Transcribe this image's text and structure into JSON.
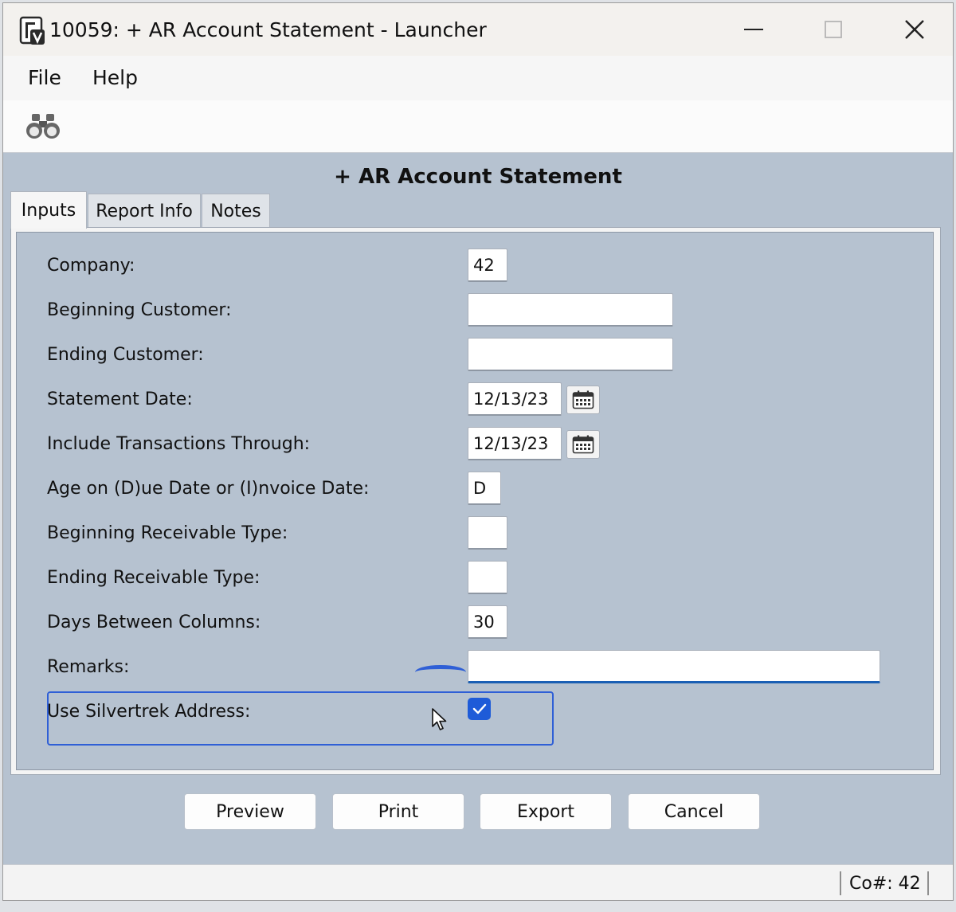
{
  "window": {
    "title": "10059: + AR Account Statement - Launcher",
    "controls": {
      "minimize": "minimize-icon",
      "maximize": "maximize-icon",
      "close": "close-icon"
    }
  },
  "menu": {
    "file": "File",
    "help": "Help"
  },
  "toolbar": {
    "find_icon": "binoculars-icon"
  },
  "form": {
    "title": "+ AR Account Statement",
    "tabs": [
      {
        "label": "Inputs",
        "active": true
      },
      {
        "label": "Report Info",
        "active": false
      },
      {
        "label": "Notes",
        "active": false
      }
    ],
    "fields": {
      "company": {
        "label": "Company:",
        "value": "42"
      },
      "beginning_customer": {
        "label": "Beginning Customer:",
        "value": ""
      },
      "ending_customer": {
        "label": "Ending Customer:",
        "value": ""
      },
      "statement_date": {
        "label": "Statement Date:",
        "value": "12/13/23"
      },
      "include_through": {
        "label": "Include Transactions Through:",
        "value": "12/13/23"
      },
      "age_on": {
        "label": "Age on (D)ue Date or (I)nvoice Date:",
        "value": "D"
      },
      "beginning_receivable_type": {
        "label": "Beginning Receivable Type:",
        "value": ""
      },
      "ending_receivable_type": {
        "label": "Ending Receivable Type:",
        "value": ""
      },
      "days_between_columns": {
        "label": "Days Between Columns:",
        "value": "30"
      },
      "remarks": {
        "label": "Remarks:",
        "value": ""
      },
      "use_silvertrek_address": {
        "label": "Use Silvertrek Address:",
        "checked": true
      }
    }
  },
  "buttons": {
    "preview": "Preview",
    "print": "Print",
    "export": "Export",
    "cancel": "Cancel"
  },
  "status": {
    "company": "Co#: 42"
  },
  "colors": {
    "form_background": "#b6c2d0",
    "accent": "#1e5bd8"
  }
}
